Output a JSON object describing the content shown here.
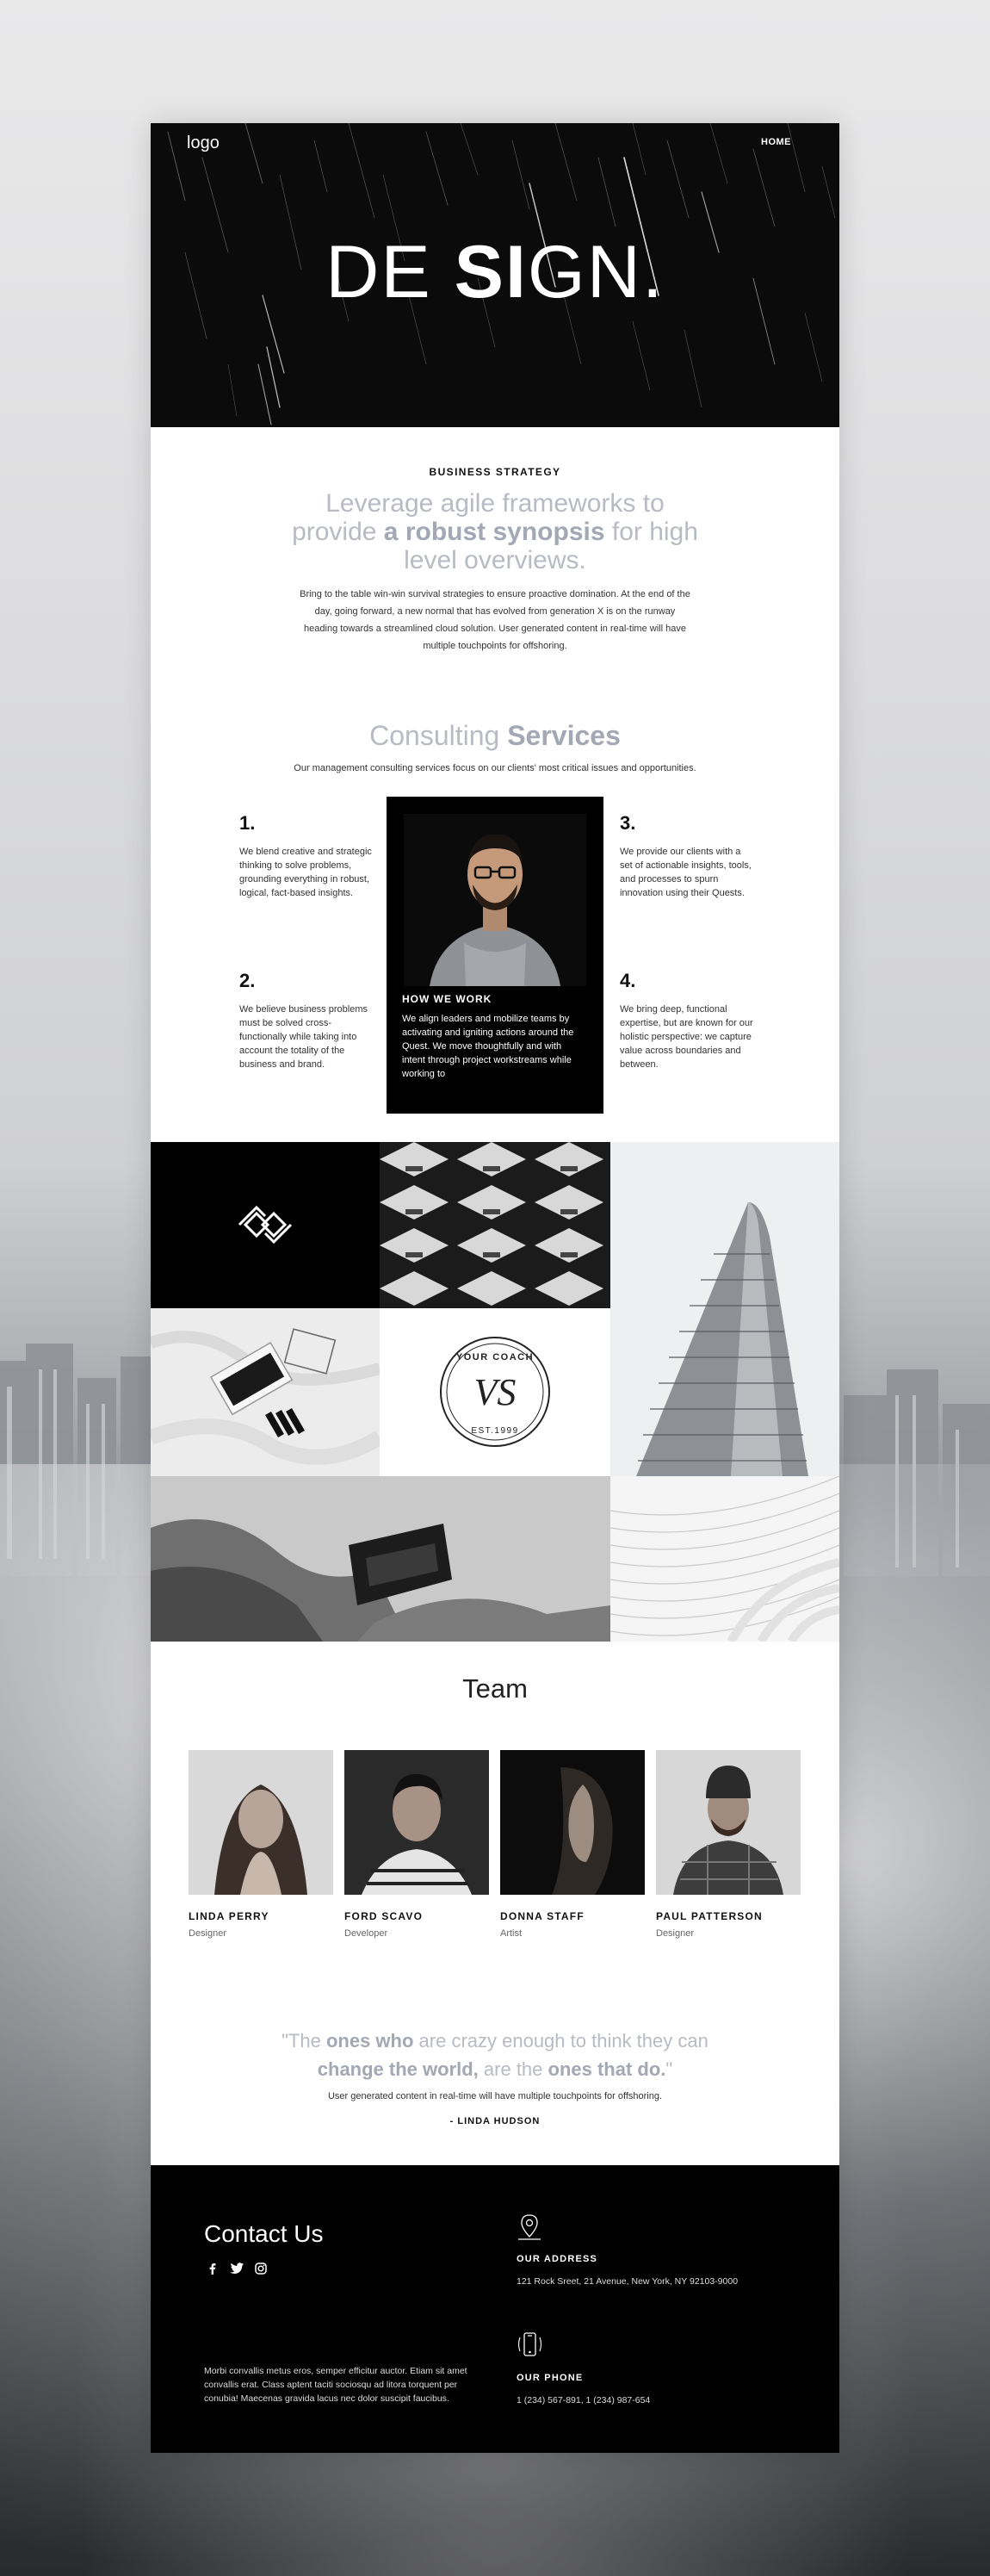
{
  "header": {
    "logo": "logo",
    "nav_home": "HOME",
    "hero_light_1": "DE ",
    "hero_bold": "SI",
    "hero_light_2": "GN."
  },
  "intro": {
    "kicker": "BUSINESS STRATEGY",
    "lead_1": "Leverage agile frameworks to provide ",
    "lead_bold": "a robust synopsis",
    "lead_2": " for high level overviews.",
    "body": "Bring to the table win-win survival strategies to ensure proactive domination. At the end of the day, going forward, a new normal that has evolved from generation X is on the runway heading towards a streamlined cloud solution. User generated content in real-time will have multiple touchpoints for offshoring."
  },
  "services": {
    "title_light": "Consulting ",
    "title_bold": "Services",
    "subtitle": "Our management consulting services focus on our clients' most critical issues and opportunities.",
    "items": [
      {
        "num": "1.",
        "text": "We blend creative and strategic thinking to solve problems, grounding everything in robust, logical, fact-based insights."
      },
      {
        "num": "2.",
        "text": "We believe business problems must be solved cross-functionally while taking into account the totality of the business and brand."
      },
      {
        "num": "3.",
        "text": "We provide our clients with a set of actionable insights, tools, and processes to spurn innovation using their Quests."
      },
      {
        "num": "4.",
        "text": "We bring deep, functional expertise, but are known for our holistic perspective: we capture value across boundaries and between."
      }
    ],
    "card": {
      "title": "HOW WE WORK",
      "text": "We align leaders and mobilize teams by activating and igniting actions around the Quest. We move thoughtfully and with intent through project workstreams while working to"
    }
  },
  "mosaic": {
    "badge_top": "YOUR COACH",
    "badge_bottom": "EST.1999",
    "badge_mono": "VS"
  },
  "team": {
    "title": "Team",
    "members": [
      {
        "name": "LINDA PERRY",
        "role": "Designer"
      },
      {
        "name": "FORD SCAVO",
        "role": "Developer"
      },
      {
        "name": "DONNA STAFF",
        "role": "Artist"
      },
      {
        "name": "PAUL PATTERSON",
        "role": "Designer"
      }
    ]
  },
  "quote": {
    "p1": "\"The ",
    "b1": "ones who",
    "p2": " are crazy enough to think they can ",
    "b2": "change the world,",
    "p3": " are the ",
    "b3": "ones that do.",
    "p4": "\"",
    "sub": "User generated content in real-time will have multiple touchpoints for offshoring.",
    "author": "- LINDA HUDSON"
  },
  "footer": {
    "contact_title": "Contact Us",
    "text": "Morbi convallis metus eros, semper efficitur auctor. Etiam sit amet convallis erat. Class aptent taciti sociosqu ad litora torquent per conubia! Maecenas gravida lacus nec dolor suscipit faucibus.",
    "address_title": "OUR ADDRESS",
    "address": "121 Rock Sreet, 21 Avenue, New York, NY 92103-9000",
    "phone_title": "OUR PHONE",
    "phone": "1 (234) 567-891, 1 (234) 987-654",
    "socials": [
      "facebook-icon",
      "twitter-icon",
      "instagram-icon"
    ]
  }
}
